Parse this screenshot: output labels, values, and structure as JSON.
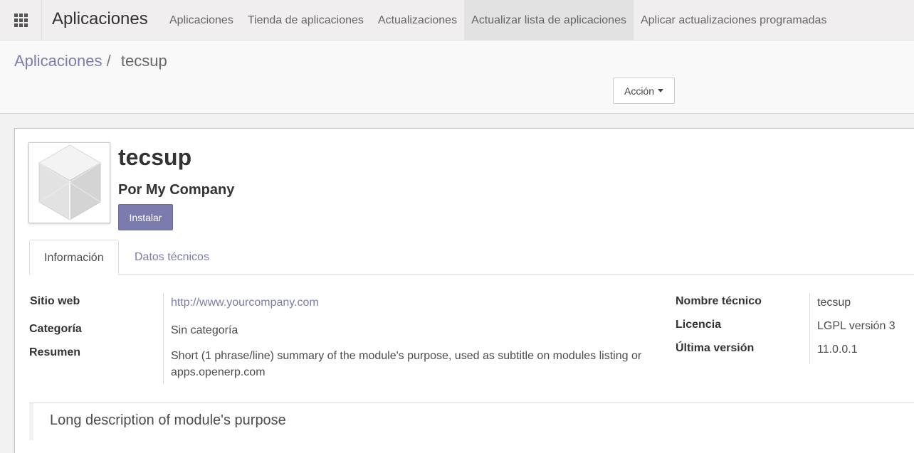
{
  "topbar": {
    "brand": "Aplicaciones",
    "menu": [
      {
        "label": "Aplicaciones"
      },
      {
        "label": "Tienda de aplicaciones"
      },
      {
        "label": "Actualizaciones"
      },
      {
        "label": "Actualizar lista de aplicaciones",
        "active": true
      },
      {
        "label": "Aplicar actualizaciones programadas"
      }
    ]
  },
  "breadcrumb": {
    "parent": "Aplicaciones",
    "separator": "/",
    "current": "tecsup"
  },
  "control_panel": {
    "action_label": "Acción"
  },
  "module": {
    "name": "tecsup",
    "author": "Por My Company",
    "install_label": "Instalar"
  },
  "tabs": {
    "info": "Información",
    "technical": "Datos técnicos"
  },
  "info": {
    "website_label": "Sitio web",
    "website_value": "http://www.yourcompany.com",
    "category_label": "Categoría",
    "category_value": "Sin categoría",
    "summary_label": "Resumen",
    "summary_value": "Short (1 phrase/line) summary of the module's purpose, used as subtitle on modules listing or apps.openerp.com",
    "technical_name_label": "Nombre técnico",
    "technical_name_value": "tecsup",
    "license_label": "Licencia",
    "license_value": "LGPL versión 3",
    "version_label": "Última versión",
    "version_value": "11.0.0.1"
  },
  "description": "Long description of module's purpose",
  "colors": {
    "accent": "#7c7bad",
    "topbar": "#f0eeee"
  }
}
